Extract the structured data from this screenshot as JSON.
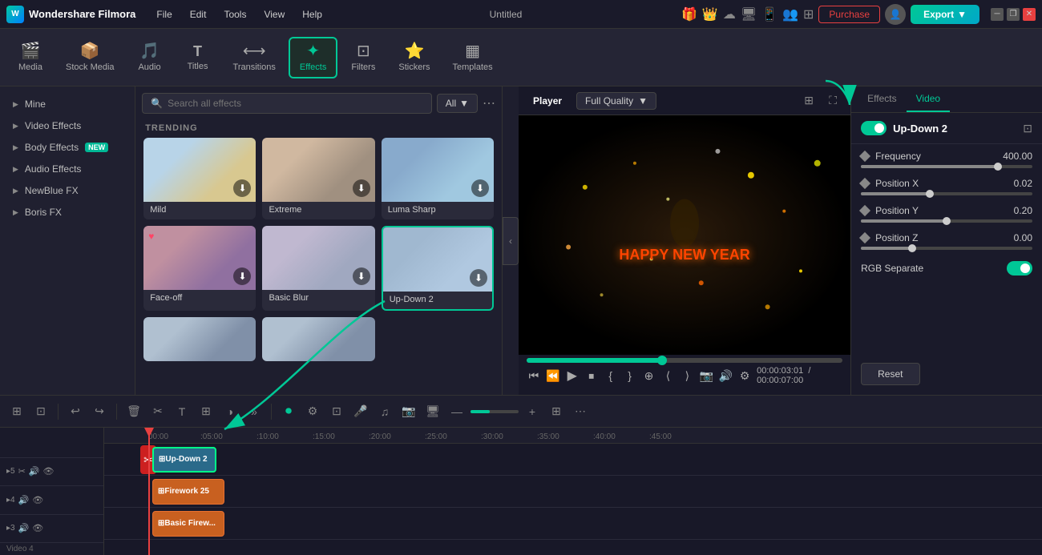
{
  "app": {
    "name": "Wondershare Filmora",
    "title": "Untitled"
  },
  "titlebar": {
    "menu": [
      "File",
      "Edit",
      "Tools",
      "View",
      "Help"
    ],
    "purchase_label": "Purchase",
    "export_label": "Export",
    "win_controls": [
      "─",
      "❐",
      "✕"
    ]
  },
  "toolbar": {
    "items": [
      {
        "id": "media",
        "icon": "🎬",
        "label": "Media"
      },
      {
        "id": "stock",
        "icon": "📦",
        "label": "Stock Media"
      },
      {
        "id": "audio",
        "icon": "🎵",
        "label": "Audio"
      },
      {
        "id": "titles",
        "icon": "T",
        "label": "Titles"
      },
      {
        "id": "transitions",
        "icon": "⟷",
        "label": "Transitions"
      },
      {
        "id": "effects",
        "icon": "✦",
        "label": "Effects",
        "active": true
      },
      {
        "id": "filters",
        "icon": "🔲",
        "label": "Filters"
      },
      {
        "id": "stickers",
        "icon": "⭐",
        "label": "Stickers"
      },
      {
        "id": "templates",
        "icon": "▦",
        "label": "Templates"
      }
    ]
  },
  "left_panel": {
    "items": [
      {
        "label": "Mine"
      },
      {
        "label": "Video Effects"
      },
      {
        "label": "Body Effects",
        "badge": "NEW"
      },
      {
        "label": "Audio Effects"
      },
      {
        "label": "NewBlue FX"
      },
      {
        "label": "Boris FX"
      }
    ]
  },
  "effects": {
    "search_placeholder": "Search all effects",
    "filter_label": "All",
    "trending_label": "TRENDING",
    "cards": [
      {
        "id": "mild",
        "name": "Mild",
        "thumb_class": "effect-thumb-mild"
      },
      {
        "id": "extreme",
        "name": "Extreme",
        "thumb_class": "effect-thumb-extreme"
      },
      {
        "id": "luma_sharp",
        "name": "Luma Sharp",
        "thumb_class": "effect-thumb-luma"
      },
      {
        "id": "faceoff",
        "name": "Face-off",
        "thumb_class": "effect-thumb-faceoff"
      },
      {
        "id": "basic_blur",
        "name": "Basic Blur",
        "thumb_class": "effect-thumb-basicblur"
      },
      {
        "id": "updown2",
        "name": "Up-Down 2",
        "thumb_class": "effect-thumb-updown",
        "active": true
      }
    ]
  },
  "player": {
    "tab": "Player",
    "quality_label": "Full Quality",
    "current_time": "00:00:03:01",
    "total_time": "00:00:07:00",
    "video_text": "HAPPY NEW YEAR"
  },
  "right_panel": {
    "tabs": [
      "Effects",
      "Video"
    ],
    "active_tab": "Video",
    "effect_name": "Up-Down 2",
    "params": [
      {
        "label": "Frequency",
        "value": "400.00",
        "fill_class": "param-slider-fill-freq",
        "thumb_class": "param-thumb-freq"
      },
      {
        "label": "Position X",
        "value": "0.02",
        "fill_class": "param-slider-fill-px",
        "thumb_class": "param-thumb-px"
      },
      {
        "label": "Position Y",
        "value": "0.20",
        "fill_class": "param-slider-fill-py",
        "thumb_class": "param-thumb-py"
      },
      {
        "label": "Position Z",
        "value": "0.00",
        "fill_class": "param-slider-fill-pz",
        "thumb_class": "param-thumb-pz"
      }
    ],
    "rgb_label": "RGB Separate",
    "reset_label": "Reset"
  },
  "timeline": {
    "tracks": [
      {
        "id": "track5",
        "label": "▸5",
        "icons": [
          "✂",
          "🔊",
          "👁"
        ]
      },
      {
        "id": "track4",
        "label": "▸4",
        "clip_label": "Firework 25",
        "sub_label": "Video 4"
      },
      {
        "id": "track3",
        "label": "▸3",
        "clip_label": "Basic Firew..."
      }
    ],
    "effect_clip": "Up-Down 2",
    "ruler_marks": [
      "00:00:05:00",
      "00:00:10:00",
      "00:00:15:00",
      "00:00:20:00",
      "00:00:25:00",
      "00:00:30:00",
      "00:00:35:00",
      "00:00:40:00",
      "00:00:45:00"
    ]
  }
}
